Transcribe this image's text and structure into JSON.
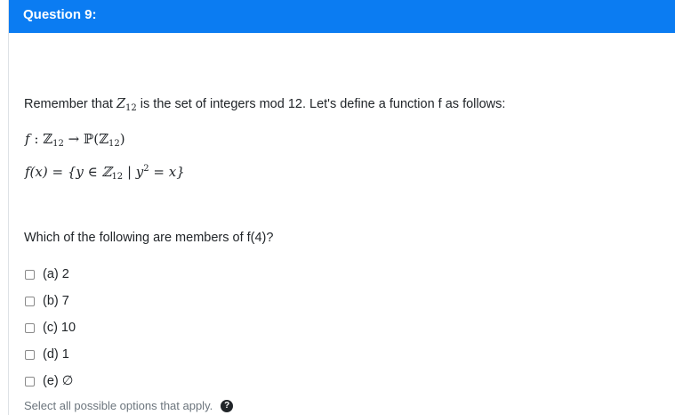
{
  "header": {
    "title": "Question 9:"
  },
  "intro": {
    "before": "Remember that ",
    "var": "Z",
    "sub": "12",
    "after": " is the set of integers mod 12.   Let's define a function f as follows:"
  },
  "formula1": {
    "f": "f",
    "colon": " : ",
    "Z": "ℤ",
    "sub": "12",
    "arrow": " → ",
    "P": "ℙ(ℤ",
    "sub2": "12",
    "close": ")"
  },
  "formula2": {
    "lhs": "f(x) = {y ∈ ℤ",
    "sub": "12",
    "mid": " | y",
    "sup": "2",
    "rhs": " = x}"
  },
  "question": "Which of the following are members of f(4)?",
  "options": [
    {
      "label": "(a) 2",
      "checked": false
    },
    {
      "label": "(b) 7",
      "checked": false
    },
    {
      "label": "(c) 10",
      "checked": false
    },
    {
      "label": "(d) 1",
      "checked": false
    },
    {
      "label": "(e) ∅",
      "checked": false
    }
  ],
  "helper": {
    "text": "Select all possible options that apply.",
    "icon": "question-circle-icon",
    "icon_glyph": "?"
  },
  "colors": {
    "header_bg": "#0b7cf2",
    "text": "#212529",
    "muted": "#6c757d"
  }
}
